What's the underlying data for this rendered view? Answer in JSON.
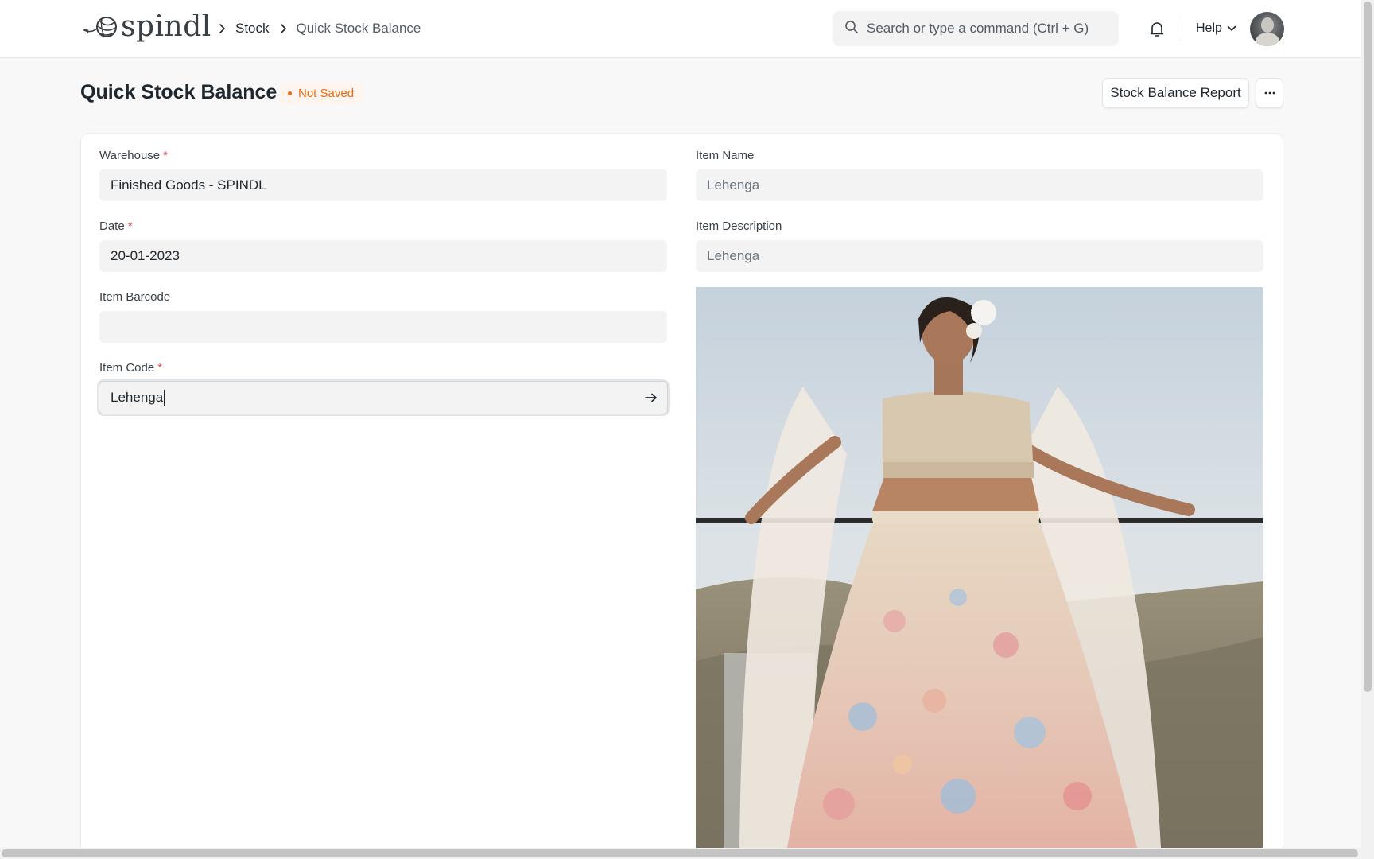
{
  "app": {
    "logo_text": "spindl"
  },
  "breadcrumb": {
    "items": [
      "Stock",
      "Quick Stock Balance"
    ]
  },
  "navbar": {
    "search_placeholder": "Search or type a command (Ctrl + G)",
    "help_label": "Help",
    "icons": [
      "search-icon",
      "bell-icon",
      "chevron-down-icon",
      "avatar"
    ]
  },
  "page": {
    "title": "Quick Stock Balance",
    "status": "Not Saved",
    "status_color": "#e86c13",
    "report_button": "Stock Balance Report",
    "more_button": "···"
  },
  "form": {
    "warehouse": {
      "label": "Warehouse",
      "required": "*",
      "value": "Finished Goods - SPINDL"
    },
    "date": {
      "label": "Date",
      "required": "*",
      "value": "20-01-2023"
    },
    "item_barcode": {
      "label": "Item Barcode",
      "value": ""
    },
    "item_code": {
      "label": "Item Code",
      "required": "*",
      "value": "Lehenga"
    },
    "item_name": {
      "label": "Item Name",
      "value": "Lehenga"
    },
    "item_description": {
      "label": "Item Description",
      "value": "Lehenga"
    }
  },
  "colors": {
    "accent": "#e86c13",
    "required": "#e24c4c",
    "input_bg": "#f3f3f3",
    "page_bg": "#f8f8f8"
  }
}
